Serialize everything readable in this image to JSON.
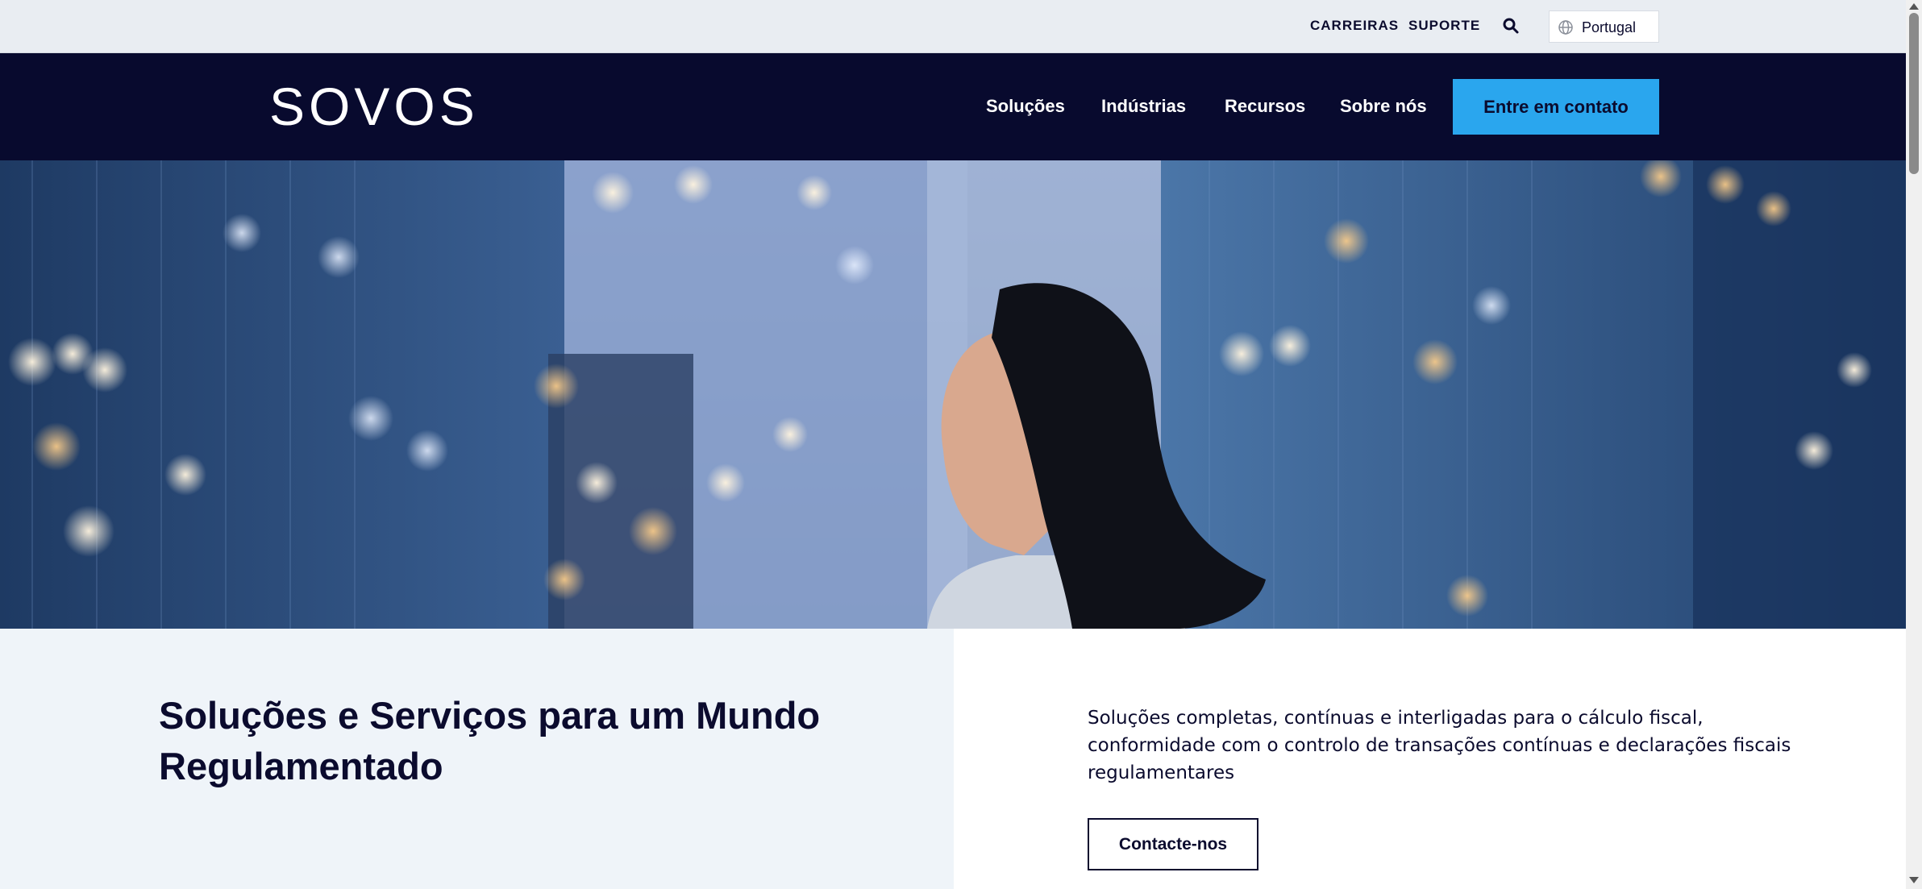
{
  "utility_bar": {
    "careers_label": "CARREIRAS",
    "support_label": "SUPORTE",
    "search_icon": "search-icon",
    "language_icon": "globe-icon",
    "language_label": "Portugal"
  },
  "nav": {
    "logo": "SOVOS",
    "items": [
      {
        "label": "Soluções"
      },
      {
        "label": "Indústrias"
      },
      {
        "label": "Recursos"
      },
      {
        "label": "Sobre nós"
      }
    ],
    "cta_label": "Entre em contato"
  },
  "hero": {
    "image": "woman-looking-up-at-city-buildings-photo"
  },
  "content": {
    "headline": "Soluções e Serviços para um Mundo Regulamentado",
    "description": "Soluções completas, contínuas e interligadas para o cálculo fiscal, conformidade com o controlo de transações contínuas e declarações fiscais regulamentares",
    "contact_button_label": "Contacte-nos"
  },
  "colors": {
    "nav_background": "#080a2e",
    "cta_background": "#2aa6ee",
    "utility_background": "#e9edf2",
    "left_panel_background": "#eff4f9",
    "text_dark": "#0b0b2e"
  }
}
